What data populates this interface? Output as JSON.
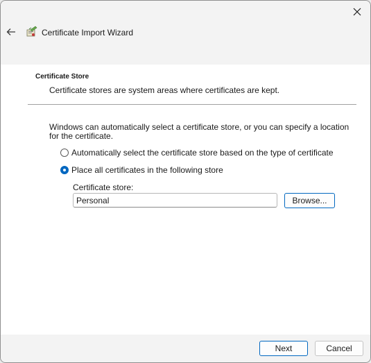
{
  "window": {
    "title": "Certificate Import Wizard",
    "close_icon": "close-icon",
    "back_icon": "back-arrow-icon",
    "app_icon": "certificate-wizard-icon"
  },
  "section": {
    "title": "Certificate Store",
    "description": "Certificate stores are system areas where certificates are kept."
  },
  "options": {
    "instructions": "Windows can automatically select a certificate store, or you can specify a location for the certificate.",
    "auto_label": "Automatically select the certificate store based on the type of certificate",
    "manual_label": "Place all certificates in the following store",
    "selected": "manual"
  },
  "store": {
    "label": "Certificate store:",
    "value": "Personal",
    "browse_label": "Browse..."
  },
  "footer": {
    "next_label": "Next",
    "cancel_label": "Cancel"
  },
  "colors": {
    "accent": "#0067c0",
    "background": "#ffffff",
    "chrome": "#f3f3f3"
  }
}
